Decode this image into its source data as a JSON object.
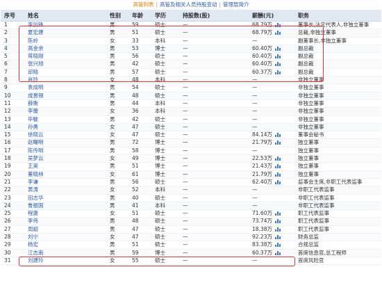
{
  "tabs": [
    "高管列表",
    "高管及相关人员持股变动",
    "管理层简介"
  ],
  "columns": [
    "序号",
    "姓名",
    "性别",
    "年龄",
    "学历",
    "持股数(股)",
    "薪酬(元)",
    "职务"
  ],
  "rows": [
    [
      "1",
      "李剑锋",
      "男",
      "59",
      "硕士",
      "—",
      "68.79万",
      "董事长,法定代表人,非独立董事"
    ],
    [
      "2",
      "夏宏建",
      "男",
      "51",
      "硕士",
      "—",
      "68.79万",
      "总裁,非独立董事"
    ],
    [
      "3",
      "陈岭",
      "女",
      "33",
      "本科",
      "—",
      "—",
      "副董事长,非独立董事"
    ],
    [
      "4",
      "高金余",
      "男",
      "53",
      "博士",
      "—",
      "60.40万",
      "副总裁"
    ],
    [
      "5",
      "蒋晓刚",
      "男",
      "56",
      "硕士",
      "—",
      "60.40万",
      "副总裁"
    ],
    [
      "6",
      "张兴旭",
      "男",
      "42",
      "硕士",
      "—",
      "60.40万",
      "副总裁"
    ],
    [
      "7",
      "邱晴",
      "男",
      "57",
      "硕士",
      "—",
      "60.37万",
      "副总裁"
    ],
    [
      "8",
      "肖玲",
      "女",
      "48",
      "本科",
      "—",
      "—",
      "非独立董事"
    ],
    [
      "9",
      "袁成明",
      "男",
      "54",
      "硕士",
      "—",
      "—",
      "非独立董事"
    ],
    [
      "10",
      "成晋锡",
      "男",
      "48",
      "硕士",
      "—",
      "—",
      "非独立董事"
    ],
    [
      "11",
      "薛衡",
      "男",
      "44",
      "本科",
      "—",
      "—",
      "非独立董事"
    ],
    [
      "12",
      "李蕾",
      "女",
      "36",
      "本科",
      "—",
      "—",
      "非独立董事"
    ],
    [
      "13",
      "毕敏",
      "男",
      "42",
      "硕士",
      "—",
      "—",
      "非独立董事"
    ],
    [
      "14",
      "孙勇",
      "女",
      "47",
      "硕士",
      "—",
      "—",
      "非独立董事"
    ],
    [
      "15",
      "徐晓云",
      "女",
      "47",
      "硕士",
      "—",
      "84.14万",
      "董事会秘书"
    ],
    [
      "16",
      "赵曙明",
      "男",
      "72",
      "博士",
      "—",
      "21.79万",
      "独立董事"
    ],
    [
      "17",
      "陈传明",
      "男",
      "58",
      "博士",
      "—",
      "—",
      "独立董事"
    ],
    [
      "18",
      "吴梦云",
      "女",
      "49",
      "博士",
      "—",
      "22.53万",
      "独立董事"
    ],
    [
      "19",
      "王昊",
      "男",
      "51",
      "博士",
      "—",
      "21.43万",
      "独立董事"
    ],
    [
      "20",
      "董晓林",
      "女",
      "61",
      "博士",
      "—",
      "21.79万",
      "独立董事"
    ],
    [
      "21",
      "李谦",
      "男",
      "56",
      "硕士",
      "—",
      "62.40万",
      "监事会主席,非职工代表监事"
    ],
    [
      "22",
      "黄涛",
      "女",
      "52",
      "本科",
      "—",
      "—",
      "非职工代表监事"
    ],
    [
      "23",
      "田志华",
      "男",
      "40",
      "硕士",
      "—",
      "—",
      "非职工代表监事"
    ],
    [
      "24",
      "鲁振国",
      "男",
      "41",
      "本科",
      "—",
      "—",
      "非职工代表监事"
    ],
    [
      "25",
      "程惠",
      "女",
      "51",
      "硕士",
      "—",
      "71.60万",
      "职工代表监事"
    ],
    [
      "26",
      "李伟",
      "男",
      "48",
      "硕士",
      "—",
      "73.74万",
      "职工代表监事"
    ],
    [
      "27",
      "周超",
      "男",
      "47",
      "硕士",
      "—",
      "18.38万",
      "职工代表监事"
    ],
    [
      "28",
      "刘宁",
      "女",
      "47",
      "硕士",
      "—",
      "92.23万",
      "财务总监"
    ],
    [
      "29",
      "杨宏",
      "男",
      "51",
      "硕士",
      "—",
      "83.38万",
      "合规总监"
    ],
    [
      "30",
      "江志南",
      "男",
      "59",
      "博士",
      "—",
      "60.37万",
      "首席信息官,总工程师"
    ],
    [
      "31",
      "刘建玲",
      "女",
      "55",
      "硕士",
      "—",
      "—",
      "首席风险官"
    ]
  ],
  "accent_colors": {
    "highlight": "#e8323a",
    "link": "#2a5caa",
    "active_tab": "#e07b00",
    "header_bg": "#dfe8f3"
  },
  "icons": {
    "salary_trend": "bar-chart-icon"
  }
}
